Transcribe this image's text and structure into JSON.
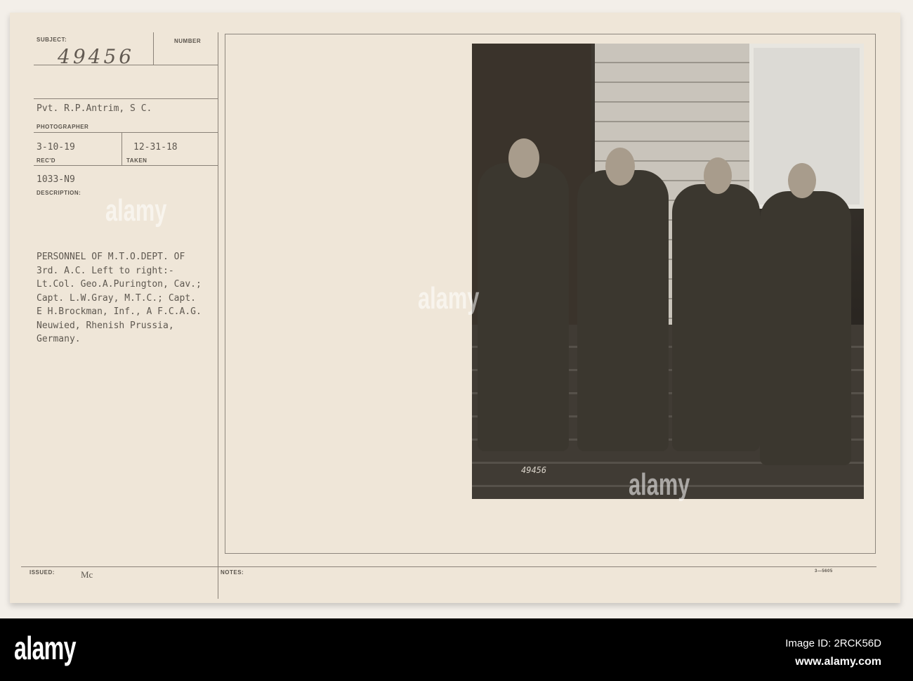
{
  "card": {
    "subject_label": "SUBJECT:",
    "subject_number": "49456",
    "number_label": "NUMBER",
    "photographer": "Pvt. R.P.Antrim, S C.",
    "photographer_label": "PHOTOGRAPHER",
    "received_date": "3-10-19",
    "received_label": "REC'D",
    "taken_date": "12-31-18",
    "taken_label": "TAKEN",
    "code": "1033-N9",
    "description_label": "DESCRIPTION:",
    "description_lines": [
      "PERSONNEL OF M.T.O.DEPT. OF",
      "3rd. A.C. Left to right:-",
      "Lt.Col. Geo.A.Purington, Cav.;",
      "Capt. L.W.Gray, M.T.C.; Capt.",
      "E H.Brockman, Inf., A F.C.A.G.",
      "Neuwied, Rhenish Prussia,",
      "Germany."
    ],
    "issued_label": "ISSUED:",
    "issued_value": "Mc",
    "notes_label": "NOTES:",
    "form_code": "3—5605",
    "photo_stamp": "49456"
  },
  "watermark": {
    "brand": "alamy",
    "image_id": "Image ID: 2RCK56D",
    "website": "www.alamy.com"
  }
}
